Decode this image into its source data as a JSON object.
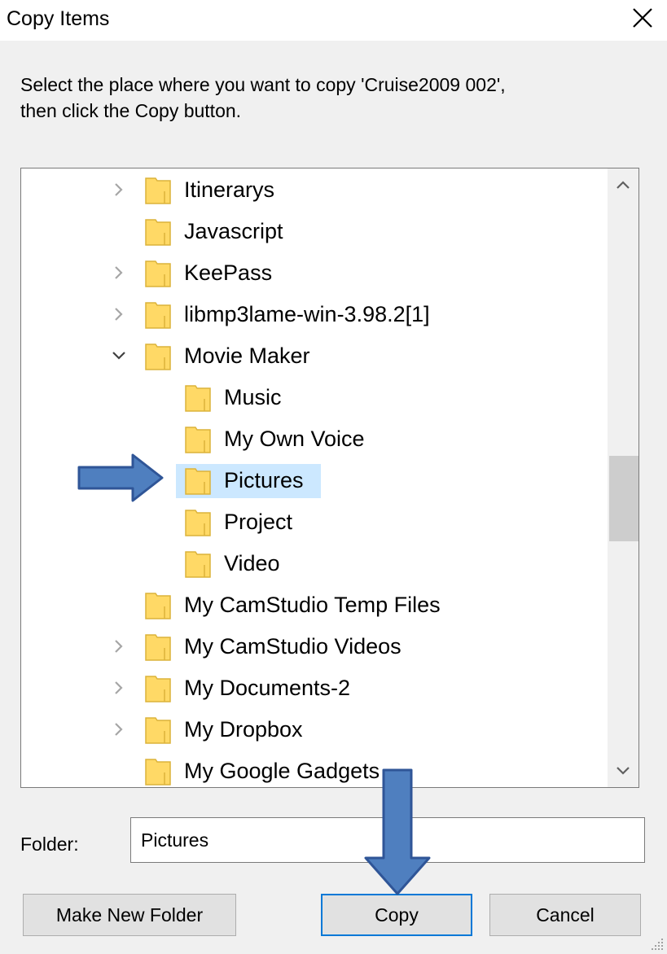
{
  "window": {
    "title": "Copy Items"
  },
  "instructions": {
    "line1": "Select the place where you want to copy 'Cruise2009 002',",
    "line2": "then click the Copy button."
  },
  "tree": {
    "items": [
      {
        "label": "Itinerarys",
        "expander": "collapsed",
        "level": 1
      },
      {
        "label": "Javascript",
        "expander": "none",
        "level": 1
      },
      {
        "label": "KeePass",
        "expander": "collapsed",
        "level": 1
      },
      {
        "label": "libmp3lame-win-3.98.2[1]",
        "expander": "collapsed",
        "level": 1
      },
      {
        "label": "Movie Maker",
        "expander": "expanded",
        "level": 1
      },
      {
        "label": "Music",
        "expander": "none",
        "level": 2
      },
      {
        "label": "My Own Voice",
        "expander": "none",
        "level": 2
      },
      {
        "label": "Pictures",
        "expander": "none",
        "level": 2,
        "selected": true
      },
      {
        "label": "Project",
        "expander": "none",
        "level": 2
      },
      {
        "label": "Video",
        "expander": "none",
        "level": 2
      },
      {
        "label": "My CamStudio Temp Files",
        "expander": "none",
        "level": 1
      },
      {
        "label": "My CamStudio Videos",
        "expander": "collapsed",
        "level": 1
      },
      {
        "label": "My Documents-2",
        "expander": "collapsed",
        "level": 1
      },
      {
        "label": "My Dropbox",
        "expander": "collapsed",
        "level": 1
      },
      {
        "label": "My Google Gadgets",
        "expander": "none",
        "level": 1
      }
    ]
  },
  "folder": {
    "label": "Folder:",
    "value": "Pictures"
  },
  "buttons": {
    "make_new_folder": "Make New Folder",
    "copy": "Copy",
    "cancel": "Cancel"
  },
  "icons": {
    "close": "close-icon",
    "folder": "folder-icon",
    "expand": "chevron-right-icon",
    "collapse": "chevron-down-icon",
    "scroll_up": "chevron-up-icon",
    "scroll_down": "chevron-down-icon",
    "annotation": "arrow-annotation-icon"
  },
  "colors": {
    "selection": "#cce8ff",
    "folder_fill": "#ffd966",
    "folder_edge": "#dcb33a",
    "annotation_arrow": "#4f7fbf",
    "default_button_border": "#0078d7"
  }
}
